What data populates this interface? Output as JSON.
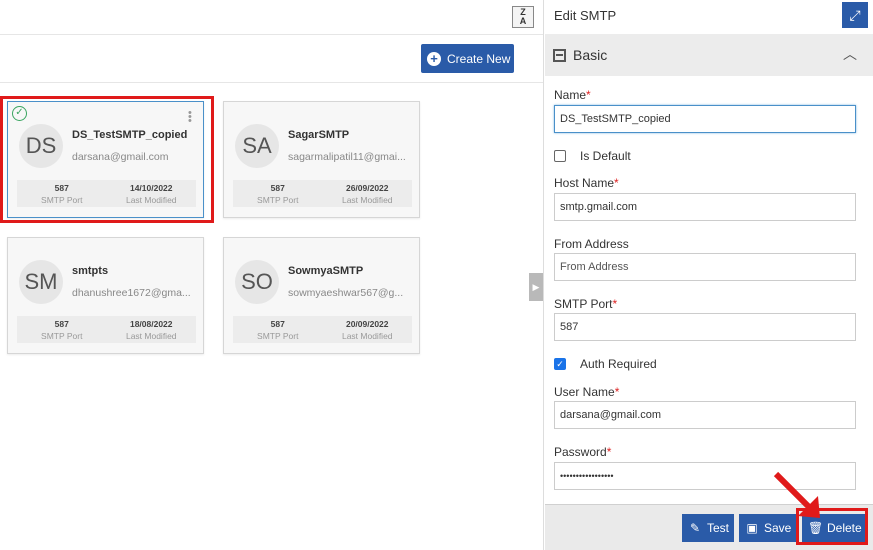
{
  "toolbar": {
    "sort_label_top": "Z",
    "sort_label_bottom": "A",
    "create_label": "Create New"
  },
  "cards": [
    {
      "initials": "DS",
      "name": "DS_TestSMTP_copied",
      "email": "darsana@gmail.com",
      "port": "587",
      "port_label": "SMTP Port",
      "modified": "14/10/2022",
      "modified_label": "Last Modified"
    },
    {
      "initials": "SA",
      "name": "SagarSMTP",
      "email": "sagarmalipatil11@gmai...",
      "port": "587",
      "port_label": "SMTP Port",
      "modified": "26/09/2022",
      "modified_label": "Last Modified"
    },
    {
      "initials": "SM",
      "name": "smtpts",
      "email": "dhanushree1672@gma...",
      "port": "587",
      "port_label": "SMTP Port",
      "modified": "18/08/2022",
      "modified_label": "Last Modified"
    },
    {
      "initials": "SO",
      "name": "SowmyaSMTP",
      "email": "sowmyaeshwar567@g...",
      "port": "587",
      "port_label": "SMTP Port",
      "modified": "20/09/2022",
      "modified_label": "Last Modified"
    }
  ],
  "panel": {
    "title": "Edit SMTP",
    "section": "Basic",
    "fields": {
      "name_label": "Name",
      "name_value": "DS_TestSMTP_copied",
      "default_label": "Is Default",
      "host_label": "Host Name",
      "host_value": "smtp.gmail.com",
      "from_label": "From Address",
      "from_placeholder": "From Address",
      "port_label": "SMTP Port",
      "port_value": "587",
      "auth_label": "Auth Required",
      "user_label": "User Name",
      "user_value": "darsana@gmail.com",
      "password_label": "Password",
      "password_value": "•••••••••••••••••"
    },
    "required_mark": "*",
    "buttons": {
      "test": "Test",
      "save": "Save",
      "delete": "Delete"
    }
  },
  "colors": {
    "primary": "#2a5ba8",
    "highlight": "#e01a1a",
    "success": "#3aa560"
  }
}
